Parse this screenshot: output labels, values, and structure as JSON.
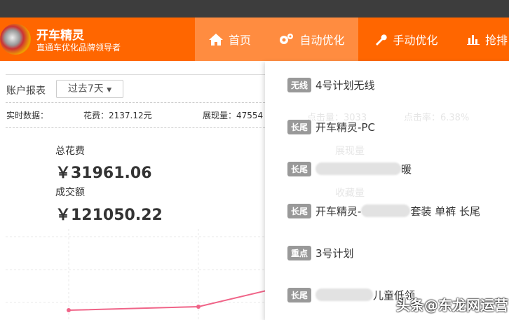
{
  "header": {
    "brand": "开车精灵",
    "slogan": "直通车优化品牌领导者",
    "nav": [
      {
        "label": "首页",
        "icon": "home-icon"
      },
      {
        "label": "自动优化",
        "icon": "gear-icon"
      },
      {
        "label": "手动优化",
        "icon": "wrench-icon"
      },
      {
        "label": "抢排",
        "icon": "bar-chart-icon"
      }
    ]
  },
  "report": {
    "title": "账户报表",
    "range": "过去7天",
    "realtime_label": "实时数据：",
    "spend": "花费：2137.12元",
    "impressions": "展现量：47554",
    "total_spend_label": "总花费",
    "total_spend": "￥31961.06",
    "deal_label": "成交额",
    "deal": "￥121050.22"
  },
  "background": {
    "clicks": "点击量：3033",
    "ctr": "点击率：6.38%",
    "imp_label": "展现量",
    "fav_label": "收藏量"
  },
  "dropdown": [
    {
      "tag": "无线",
      "name": "4号计划无线"
    },
    {
      "tag": "长尾",
      "name": "开车精灵-PC"
    },
    {
      "tag": "长尾",
      "name": "暖",
      "blurred": true
    },
    {
      "tag": "长尾",
      "name": "开车精灵-",
      "suffix": "套装 单裤 长尾",
      "blurred": true
    },
    {
      "tag": "重点",
      "name": "3号计划"
    },
    {
      "tag": "长尾",
      "name": "儿童低领",
      "blurred": true
    }
  ],
  "watermark": "头条@东龙网运营"
}
